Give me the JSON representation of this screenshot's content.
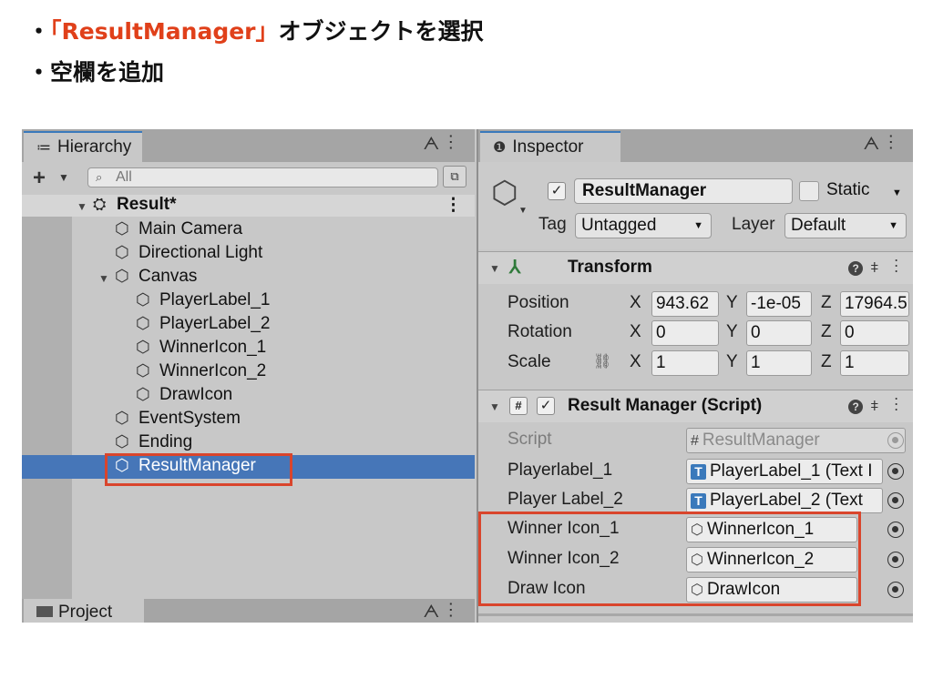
{
  "instructions": {
    "line1_prefix": "・",
    "line1_highlight": "「ResultManager」",
    "line1_suffix": "オブジェクトを選択",
    "line2": "・空欄を追加"
  },
  "colors": {
    "highlight_text": "#e0401a",
    "selection": "#4676b8",
    "red_box": "#d9452c",
    "tab_accent": "#3a79bb"
  },
  "hierarchy": {
    "tab_icon": "≔",
    "tab_label": "Hierarchy",
    "tab_actions": "⌂ ⋮",
    "add_label": "+",
    "search_placeholder": "All",
    "scene_name": "Result*",
    "items": [
      {
        "label": "Main Camera",
        "icon": "cube-icon"
      },
      {
        "label": "Directional Light",
        "icon": "cube-icon"
      },
      {
        "label": "Canvas",
        "icon": "cube-icon",
        "expanded": true
      },
      {
        "label": "PlayerLabel_1",
        "icon": "cube-icon"
      },
      {
        "label": "PlayerLabel_2",
        "icon": "cube-icon"
      },
      {
        "label": "WinnerIcon_1",
        "icon": "cube-icon"
      },
      {
        "label": "WinnerIcon_2",
        "icon": "cube-icon"
      },
      {
        "label": "DrawIcon",
        "icon": "cube-icon"
      },
      {
        "label": "EventSystem",
        "icon": "cube-icon"
      },
      {
        "label": "Ending",
        "icon": "cube-icon"
      },
      {
        "label": "ResultManager",
        "icon": "cube-icon",
        "selected": true
      }
    ]
  },
  "project": {
    "tab_label": "Project"
  },
  "inspector": {
    "tab_icon": "❶",
    "tab_label": "Inspector",
    "object_name": "ResultManager",
    "static_label": "Static",
    "tag_label": "Tag",
    "tag_value": "Untagged",
    "layer_label": "Layer",
    "layer_value": "Default",
    "transform": {
      "title": "Transform",
      "position_label": "Position",
      "rotation_label": "Rotation",
      "scale_label": "Scale",
      "position": {
        "x": "943.62",
        "y": "-1e-05",
        "z": "17964.5"
      },
      "rotation": {
        "x": "0",
        "y": "0",
        "z": "0"
      },
      "scale": {
        "x": "1",
        "y": "1",
        "z": "1"
      }
    },
    "script_component": {
      "title": "Result Manager (Script)",
      "fields": [
        {
          "label": "Script",
          "value": "ResultManager",
          "kind": "script",
          "disabled": true
        },
        {
          "label": "Playerlabel_1",
          "value": "PlayerLabel_1 (Text I",
          "kind": "text"
        },
        {
          "label": "Player Label_2",
          "value": "PlayerLabel_2 (Text",
          "kind": "text"
        },
        {
          "label": "Winner Icon_1",
          "value": "WinnerIcon_1",
          "kind": "gameobject"
        },
        {
          "label": "Winner Icon_2",
          "value": "WinnerIcon_2",
          "kind": "gameobject"
        },
        {
          "label": "Draw Icon",
          "value": "DrawIcon",
          "kind": "gameobject"
        }
      ]
    }
  }
}
